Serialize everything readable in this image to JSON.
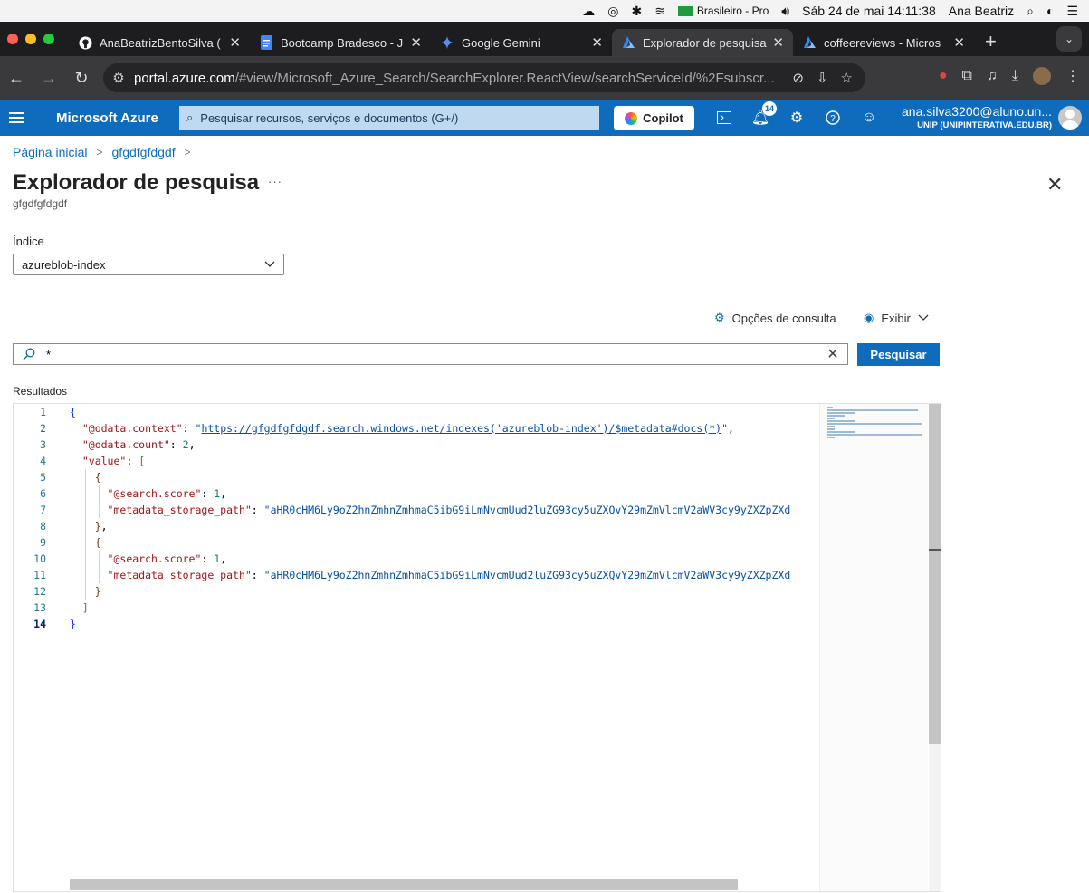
{
  "menubar": {
    "input_source": "Brasileiro - Pro",
    "datetime": "Sáb 24 de mai  14:11:38",
    "user": "Ana Beatriz"
  },
  "browser": {
    "tabs": [
      {
        "label": "AnaBeatrizBentoSilva (",
        "icon": "github-icon"
      },
      {
        "label": "Bootcamp Bradesco - J",
        "icon": "docs-icon"
      },
      {
        "label": "Google Gemini",
        "icon": "gemini-icon"
      },
      {
        "label": "Explorador de pesquisa",
        "icon": "azure-icon",
        "active": true
      },
      {
        "label": "coffeereviews - Micros",
        "icon": "azure-icon"
      }
    ],
    "url_host": "portal.azure.com",
    "url_path": "/#view/Microsoft_Azure_Search/SearchExplorer.ReactView/searchServiceId/%2Fsubscr..."
  },
  "azure": {
    "brand": "Microsoft Azure",
    "search_placeholder": "Pesquisar recursos, serviços e documentos (G+/)",
    "copilot_label": "Copilot",
    "notifications_count": "14",
    "account_email": "ana.silva3200@aluno.un...",
    "account_org": "UNIP (UNIPINTERATIVA.EDU.BR)",
    "colors": {
      "header": "#0f6cbd",
      "accent": "#0f6cbd"
    }
  },
  "page": {
    "breadcrumb": [
      "Página inicial",
      "gfgdfgfdgdf"
    ],
    "title": "Explorador de pesquisa",
    "more": "···",
    "subtitle": "gfgdfgfdgdf",
    "index_label": "Índice",
    "index_value": "azureblob-index",
    "query_options_label": "Opções de consulta",
    "view_label": "Exibir",
    "query_value": "*",
    "search_button": "Pesquisar",
    "results_label": "Resultados"
  },
  "results_json": {
    "line_numbers": [
      "1",
      "2",
      "3",
      "4",
      "5",
      "6",
      "7",
      "8",
      "9",
      "10",
      "11",
      "12",
      "13",
      "14"
    ],
    "odata_context_key": "\"@odata.context\"",
    "odata_context_value": "https://gfgdfgfdgdf.search.windows.net/indexes('azureblob-index')/$metadata#docs(*)",
    "odata_count_key": "\"@odata.count\"",
    "odata_count_value": "2",
    "value_key": "\"value\"",
    "score_key": "\"@search.score\"",
    "score_value": "1",
    "path_key": "\"metadata_storage_path\"",
    "path_value": "\"aHR0cHM6Ly9oZ2hnZmhnZmhmaC5ibG9iLmNvcmUud2luZG93cy5uZXQvY29mZmVlcmV2aWV3cy9yZXZpZXd"
  }
}
